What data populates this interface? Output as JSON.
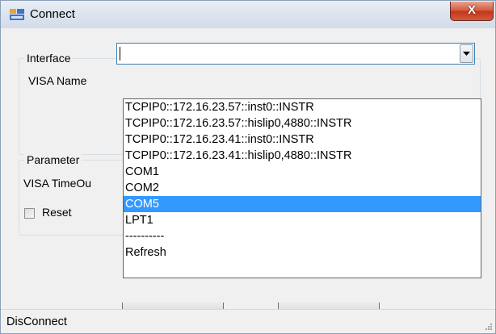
{
  "window": {
    "title": "Connect",
    "close_glyph": "X"
  },
  "interface_group": {
    "legend": "Interface",
    "visa_name_label": "VISA Name",
    "visa_name_value": ""
  },
  "parameter_group": {
    "legend": "Parameter",
    "visa_timeout_label": "VISA TimeOu",
    "reset_label": "Reset",
    "reset_checked": false
  },
  "dropdown": {
    "items": [
      "TCPIP0::172.16.23.57::inst0::INSTR",
      "TCPIP0::172.16.23.57::hislip0,4880::INSTR",
      "TCPIP0::172.16.23.41::inst0::INSTR",
      "TCPIP0::172.16.23.41::hislip0,4880::INSTR",
      "COM1",
      "COM2",
      "COM5",
      "LPT1",
      "----------",
      "Refresh"
    ],
    "selected": "COM5"
  },
  "status_bar": {
    "text": "DisConnect"
  },
  "colors": {
    "selection": "#3399ff",
    "close_button": "#c2361a",
    "window_bg": "#f0f0f0"
  }
}
